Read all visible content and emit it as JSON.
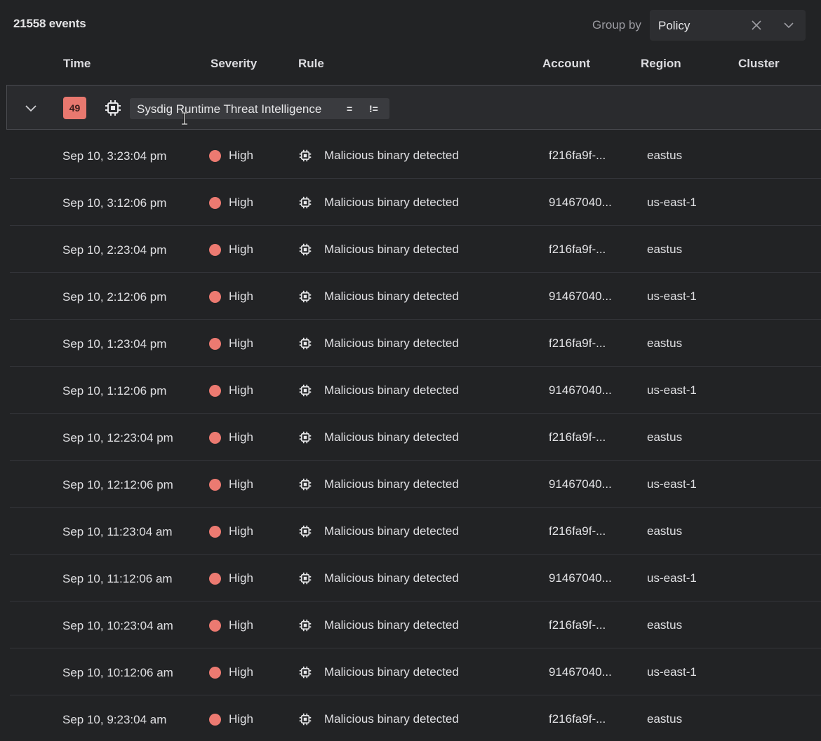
{
  "toolbar": {
    "event_count": "21558 events",
    "group_by_label": "Group by",
    "group_by_value": "Policy"
  },
  "columns": {
    "time": "Time",
    "severity": "Severity",
    "rule": "Rule",
    "account": "Account",
    "region": "Region",
    "cluster": "Cluster"
  },
  "group": {
    "count": "49",
    "policy_name": "Sysdig Runtime Threat Intelligence",
    "eq_label": "=",
    "neq_label": "!="
  },
  "colors": {
    "severity_high": "#ec7a71",
    "count_badge": "#e8786f"
  },
  "icons": {
    "rule": "cpu-chip-icon",
    "collapse": "chevron-down-icon",
    "clear": "close-icon"
  },
  "rows": [
    {
      "time": "Sep 10, 3:23:04 pm",
      "severity": "High",
      "rule": "Malicious binary detected",
      "account": "f216fa9f-...",
      "region": "eastus"
    },
    {
      "time": "Sep 10, 3:12:06 pm",
      "severity": "High",
      "rule": "Malicious binary detected",
      "account": "91467040...",
      "region": "us-east-1"
    },
    {
      "time": "Sep 10, 2:23:04 pm",
      "severity": "High",
      "rule": "Malicious binary detected",
      "account": "f216fa9f-...",
      "region": "eastus"
    },
    {
      "time": "Sep 10, 2:12:06 pm",
      "severity": "High",
      "rule": "Malicious binary detected",
      "account": "91467040...",
      "region": "us-east-1"
    },
    {
      "time": "Sep 10, 1:23:04 pm",
      "severity": "High",
      "rule": "Malicious binary detected",
      "account": "f216fa9f-...",
      "region": "eastus"
    },
    {
      "time": "Sep 10, 1:12:06 pm",
      "severity": "High",
      "rule": "Malicious binary detected",
      "account": "91467040...",
      "region": "us-east-1"
    },
    {
      "time": "Sep 10, 12:23:04 pm",
      "severity": "High",
      "rule": "Malicious binary detected",
      "account": "f216fa9f-...",
      "region": "eastus"
    },
    {
      "time": "Sep 10, 12:12:06 pm",
      "severity": "High",
      "rule": "Malicious binary detected",
      "account": "91467040...",
      "region": "us-east-1"
    },
    {
      "time": "Sep 10, 11:23:04 am",
      "severity": "High",
      "rule": "Malicious binary detected",
      "account": "f216fa9f-...",
      "region": "eastus"
    },
    {
      "time": "Sep 10, 11:12:06 am",
      "severity": "High",
      "rule": "Malicious binary detected",
      "account": "91467040...",
      "region": "us-east-1"
    },
    {
      "time": "Sep 10, 10:23:04 am",
      "severity": "High",
      "rule": "Malicious binary detected",
      "account": "f216fa9f-...",
      "region": "eastus"
    },
    {
      "time": "Sep 10, 10:12:06 am",
      "severity": "High",
      "rule": "Malicious binary detected",
      "account": "91467040...",
      "region": "us-east-1"
    },
    {
      "time": "Sep 10, 9:23:04 am",
      "severity": "High",
      "rule": "Malicious binary detected",
      "account": "f216fa9f-...",
      "region": "eastus"
    }
  ]
}
